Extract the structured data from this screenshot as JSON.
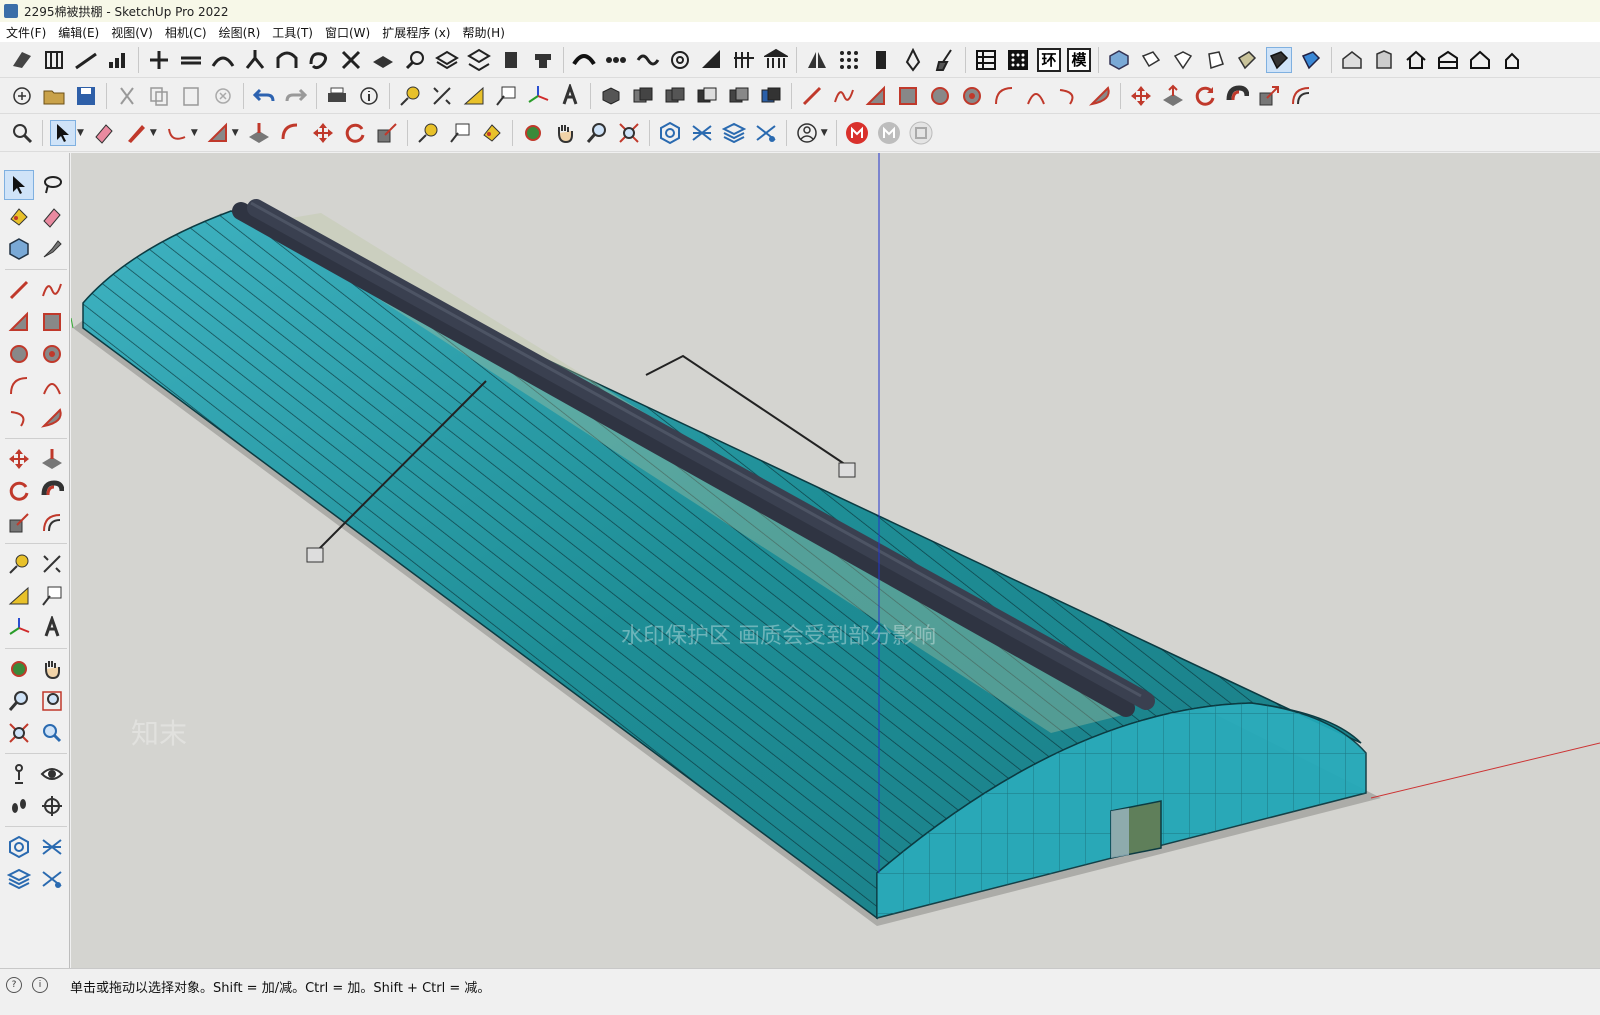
{
  "window": {
    "title": "2295棉被拱棚 - SketchUp Pro 2022"
  },
  "menu": [
    "文件(F)",
    "编辑(E)",
    "视图(V)",
    "相机(C)",
    "绘图(R)",
    "工具(T)",
    "窗口(W)",
    "扩展程序 (x)",
    "帮助(H)"
  ],
  "toolbar": {
    "letter_buttons": [
      "环",
      "模"
    ]
  },
  "viewport": {
    "watermark_text": "水印保护区  画质会受到部分影响",
    "watermark_brand": "知末",
    "colors": {
      "background": "#d4d4d0",
      "glazing": "#1e8e96",
      "glazing_light": "#3fb3c2",
      "roll": "#353b4a",
      "ground": "#8a8a86"
    }
  },
  "status": {
    "message": "单击或拖动以选择对象。Shift = 加/减。Ctrl = 加。Shift + Ctrl = 减。"
  }
}
